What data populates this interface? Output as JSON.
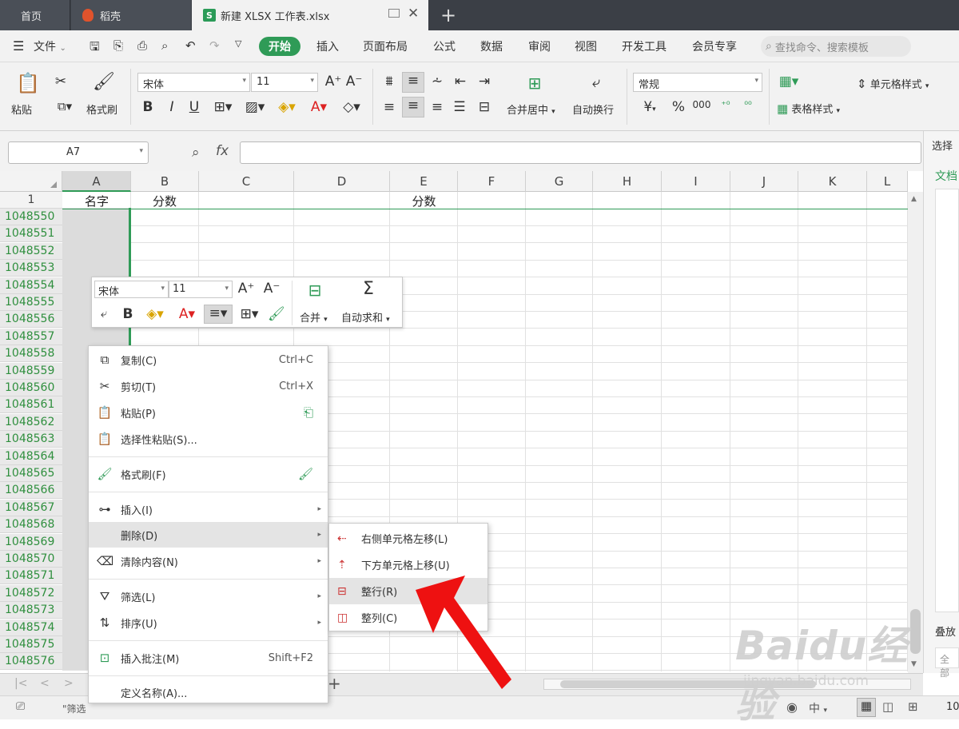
{
  "tabs": {
    "home": "首页",
    "daoke": "稻壳",
    "file": "新建 XLSX 工作表.xlsx",
    "file_badge": "S"
  },
  "menubar": {
    "file_menu": "文件",
    "items": [
      "开始",
      "插入",
      "页面布局",
      "公式",
      "数据",
      "审阅",
      "视图",
      "开发工具",
      "会员专享"
    ],
    "search_placeholder": "查找命令、搜索模板"
  },
  "ribbon": {
    "paste": "粘贴",
    "format_painter": "格式刷",
    "font_name": "宋体",
    "font_size": "11",
    "merge_center": "合并居中",
    "auto_wrap": "自动换行",
    "number_format": "常规",
    "cell_style": "单元格样式",
    "table_style": "表格样式",
    "percent": "%",
    "currency": "¥"
  },
  "formula_bar": {
    "cell_ref": "A7",
    "fx": "fx",
    "value": ""
  },
  "sheet": {
    "columns": [
      "A",
      "B",
      "C",
      "D",
      "E",
      "F",
      "G",
      "H",
      "I",
      "J",
      "K",
      "L"
    ],
    "row1_num": "1",
    "row1_cells": {
      "A": "名字",
      "B": "分数",
      "E": "分数"
    },
    "row_numbers": [
      "1048550",
      "1048551",
      "1048552",
      "1048553",
      "1048554",
      "1048555",
      "1048556",
      "1048557",
      "1048558",
      "1048559",
      "1048560",
      "1048561",
      "1048562",
      "1048563",
      "1048564",
      "1048565",
      "1048566",
      "1048567",
      "1048568",
      "1048569",
      "1048570",
      "1048571",
      "1048572",
      "1048573",
      "1048574",
      "1048575",
      "1048576"
    ]
  },
  "side_panel": {
    "title": "选择",
    "doc": "文档",
    "stack": "叠放",
    "all": "全部"
  },
  "mini_toolbar": {
    "font_name": "宋体",
    "font_size": "11",
    "merge": "合并",
    "autosum": "自动求和"
  },
  "context_menu": {
    "items": [
      {
        "label": "复制(C)",
        "shortcut": "Ctrl+C",
        "icon": "copy-icon"
      },
      {
        "label": "剪切(T)",
        "shortcut": "Ctrl+X",
        "icon": "scissors-icon"
      },
      {
        "label": "粘贴(P)",
        "shortcut": "",
        "icon": "paste-icon"
      },
      {
        "label": "选择性粘贴(S)...",
        "shortcut": "",
        "icon": "paste-special-icon"
      },
      {
        "label": "格式刷(F)",
        "shortcut": "",
        "icon": "brush-icon"
      },
      {
        "label": "插入(I)",
        "shortcut": "",
        "icon": "insert-icon"
      },
      {
        "label": "删除(D)",
        "shortcut": "",
        "icon": "delete-icon"
      },
      {
        "label": "清除内容(N)",
        "shortcut": "",
        "icon": "eraser-icon"
      },
      {
        "label": "筛选(L)",
        "shortcut": "",
        "icon": "filter-icon"
      },
      {
        "label": "排序(U)",
        "shortcut": "",
        "icon": "sort-icon"
      },
      {
        "label": "插入批注(M)",
        "shortcut": "Shift+F2",
        "icon": "comment-icon"
      },
      {
        "label": "定义名称(A)...",
        "shortcut": "",
        "icon": ""
      }
    ]
  },
  "delete_submenu": {
    "items": [
      {
        "label": "右侧单元格左移(L)",
        "icon": "shift-left-icon"
      },
      {
        "label": "下方单元格上移(U)",
        "icon": "shift-up-icon"
      },
      {
        "label": "整行(R)",
        "icon": "delete-row-icon"
      },
      {
        "label": "整列(C)",
        "icon": "delete-column-icon"
      }
    ]
  },
  "status_bar": {
    "filter_hint": "\"筛选",
    "zoom_prefix": "10",
    "lang": "中"
  },
  "watermark": {
    "brand": "Baidu经验",
    "url": "jingyan.baidu.com"
  },
  "colors": {
    "accent_green": "#2f9b57",
    "row_header_green": "#2f8f3e",
    "arrow_red": "#ee1111"
  }
}
